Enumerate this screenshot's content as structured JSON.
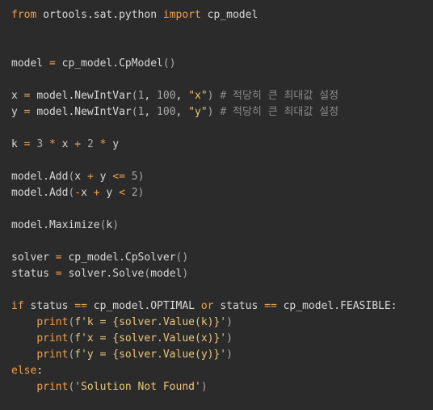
{
  "window": {
    "type": "code-editor",
    "language": "python"
  },
  "colors": {
    "background": "#2b2b2b",
    "default_text": "#d8d8d8",
    "keyword": "#f0a04b",
    "number": "#a9a9a9",
    "string": "#e8c67a",
    "comment": "#8a8a8a"
  },
  "code": {
    "lines": [
      "from ortools.sat.python import cp_model",
      "",
      "",
      "model = cp_model.CpModel()",
      "",
      "x = model.NewIntVar(1, 100, \"x\") # 적당히 큰 최대값 설정",
      "y = model.NewIntVar(1, 100, \"y\") # 적당히 큰 최대값 설정",
      "",
      "k = 3 * x + 2 * y",
      "",
      "model.Add(x + y <= 5)",
      "model.Add(-x + y < 2)",
      "",
      "model.Maximize(k)",
      "",
      "solver = cp_model.CpSolver()",
      "status = solver.Solve(model)",
      "",
      "if status == cp_model.OPTIMAL or status == cp_model.FEASIBLE:",
      "    print(f'k = {solver.Value(k)}')",
      "    print(f'x = {solver.Value(x)}')",
      "    print(f'y = {solver.Value(y)}')",
      "else:",
      "    print('Solution Not Found')"
    ]
  }
}
